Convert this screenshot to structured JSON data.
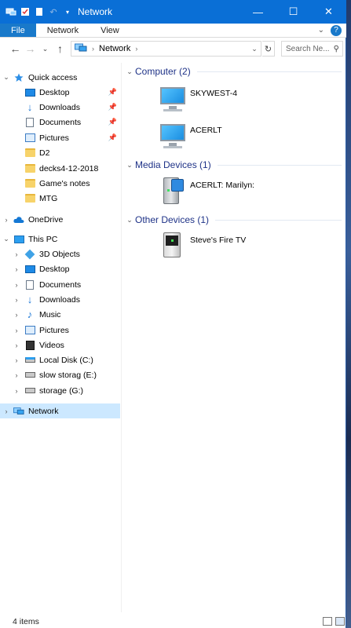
{
  "window": {
    "title": "Network"
  },
  "ribbon": {
    "tabs": [
      "File",
      "Network",
      "View"
    ]
  },
  "address": {
    "crumbs": [
      "Network"
    ],
    "search_placeholder": "Search Ne..."
  },
  "quick_access": {
    "label": "Quick access",
    "items": [
      {
        "label": "Desktop",
        "icon": "desktop-icon",
        "pinned": true
      },
      {
        "label": "Downloads",
        "icon": "downloads-icon",
        "pinned": true
      },
      {
        "label": "Documents",
        "icon": "documents-icon",
        "pinned": true
      },
      {
        "label": "Pictures",
        "icon": "pictures-icon",
        "pinned": true
      },
      {
        "label": "D2",
        "icon": "folder-icon",
        "pinned": false
      },
      {
        "label": "decks4-12-2018",
        "icon": "folder-icon",
        "pinned": false
      },
      {
        "label": "Game's notes",
        "icon": "folder-icon",
        "pinned": false
      },
      {
        "label": "MTG",
        "icon": "folder-icon",
        "pinned": false
      }
    ]
  },
  "onedrive": {
    "label": "OneDrive"
  },
  "this_pc": {
    "label": "This PC",
    "items": [
      {
        "label": "3D Objects",
        "icon": "3d-objects-icon"
      },
      {
        "label": "Desktop",
        "icon": "desktop-icon"
      },
      {
        "label": "Documents",
        "icon": "documents-icon"
      },
      {
        "label": "Downloads",
        "icon": "downloads-icon"
      },
      {
        "label": "Music",
        "icon": "music-icon"
      },
      {
        "label": "Pictures",
        "icon": "pictures-icon"
      },
      {
        "label": "Videos",
        "icon": "videos-icon"
      },
      {
        "label": "Local Disk (C:)",
        "icon": "local-disk-icon"
      },
      {
        "label": "slow storag (E:)",
        "icon": "drive-icon"
      },
      {
        "label": "storage (G:)",
        "icon": "drive-icon"
      }
    ]
  },
  "network_node": {
    "label": "Network"
  },
  "groups": {
    "computer": {
      "title": "Computer (2)",
      "devices": [
        "SKYWEST-4",
        "ACERLT"
      ]
    },
    "media": {
      "title": "Media Devices (1)",
      "devices": [
        "ACERLT: Marilyn:"
      ]
    },
    "other": {
      "title": "Other Devices (1)",
      "devices": [
        "Steve's Fire TV"
      ]
    }
  },
  "status": {
    "count": "4 items"
  },
  "colors": {
    "titlebar": "#0a6fd6",
    "file_tab": "#1979ca",
    "selection": "#cce8ff",
    "group_title": "#1e3287"
  }
}
